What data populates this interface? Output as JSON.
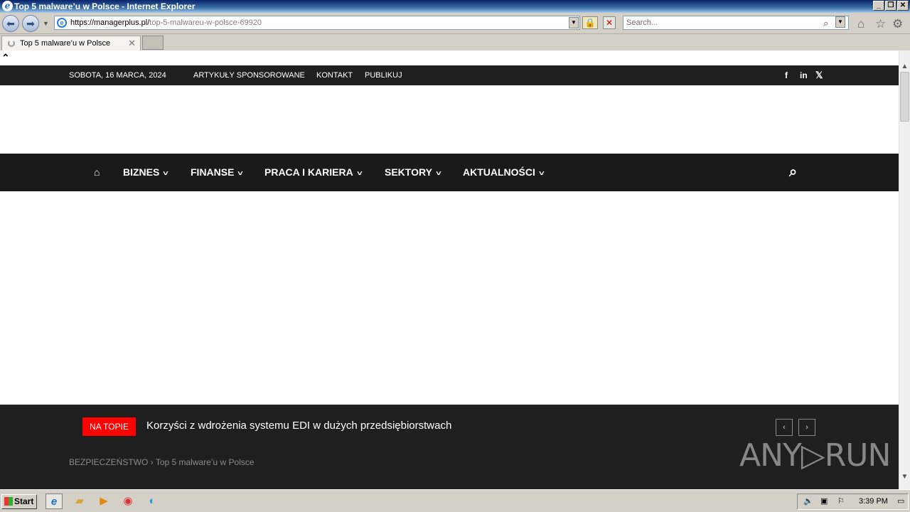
{
  "window": {
    "title": "Top 5 malware’u w Polsce - Internet Explorer",
    "minimize": "_",
    "restore": "❐",
    "close": "✕"
  },
  "browser": {
    "url_domain": "https://managerplus.pl/",
    "url_path": "top-5-malwareu-w-polsce-69920",
    "search_placeholder": "Search...",
    "tab_title": "Top 5 malware’u w Polsce",
    "tab_close": "✕"
  },
  "site": {
    "date": "SOBOTA, 16 MARCA, 2024",
    "top_links": [
      "ARTYKUŁY SPONSOROWANE",
      "KONTAKT",
      "PUBLIKUJ"
    ],
    "social": {
      "facebook": "f",
      "linkedin": "in",
      "x": "𝕏"
    },
    "nav": [
      "BIZNES",
      "FINANSE",
      "PRACA I KARIERA",
      "SEKTORY",
      "AKTUALNOŚCI"
    ],
    "ticker_badge": "NA TOPIE",
    "ticker_headline": "Korzyści z wdrożenia systemu EDI w dużych przedsiębiorstwach",
    "breadcrumb_category": "BEZPIECZEŃSTWO",
    "breadcrumb_sep": "›",
    "breadcrumb_current": "Top 5 malware’u w Polsce",
    "watermark": "ANY▷RUN"
  },
  "taskbar": {
    "start": "Start",
    "clock": "3:39 PM"
  }
}
